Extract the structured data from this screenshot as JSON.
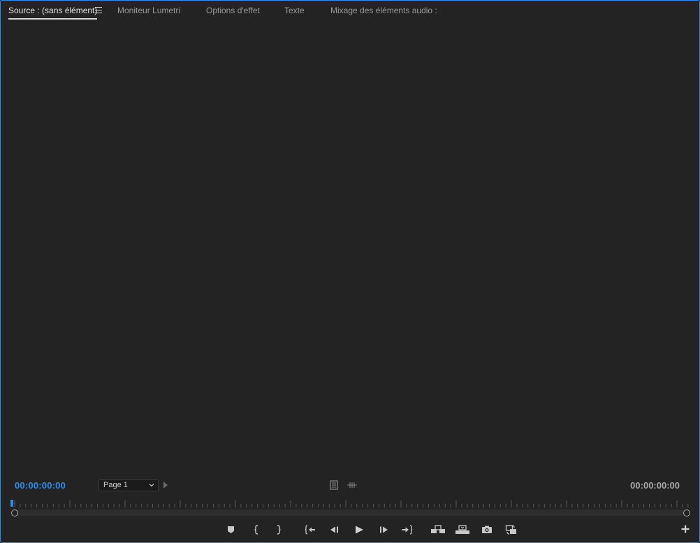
{
  "tabs": [
    {
      "label": "Source : (sans élément)",
      "active": true
    },
    {
      "label": "Moniteur Lumetri",
      "active": false
    },
    {
      "label": "Options d'effet",
      "active": false
    },
    {
      "label": "Texte",
      "active": false
    },
    {
      "label": "Mixage des éléments audio :",
      "active": false
    }
  ],
  "timecode": {
    "current": "00:00:00:00",
    "duration": "00:00:00:00"
  },
  "page_select": {
    "value": "Page 1"
  },
  "transport": {
    "buttons": [
      "add-marker-icon",
      "mark-in-icon",
      "mark-out-icon",
      "go-to-in-icon",
      "step-back-icon",
      "play-icon",
      "step-forward-icon",
      "go-to-out-icon",
      "insert-icon",
      "overwrite-icon",
      "export-frame-icon",
      "drag-video-audio-icon"
    ],
    "add_button": "plus-icon"
  },
  "colors": {
    "accent": "#2d8ceb",
    "panel_bg": "#232323",
    "icon": "#c8c8c8"
  }
}
